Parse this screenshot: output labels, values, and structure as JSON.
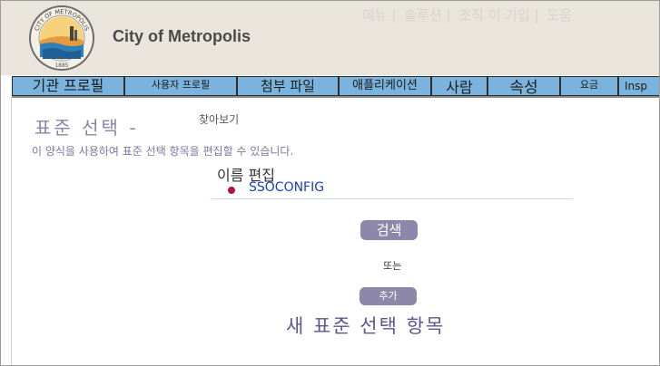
{
  "header": {
    "city_name": "City of Metropolis",
    "logo": {
      "top_text": "CITY OF METROPOLIS",
      "year": "1885"
    },
    "top_links": [
      "메뉴 |",
      "솔루션 |",
      "조직 이 가입 |",
      "도움"
    ]
  },
  "tabs": [
    {
      "label": "기관 프로필"
    },
    {
      "label": "사용자 프로필"
    },
    {
      "label": "첨부 파일"
    },
    {
      "label": "애플리케이션"
    },
    {
      "label": "사람"
    },
    {
      "label": "속성"
    },
    {
      "label": "요금"
    },
    {
      "label": "Insp"
    }
  ],
  "main": {
    "title": "표준 선택 -",
    "browse_link": "찾아보기",
    "description": "이 양식을 사용하여 표준 선택 항목을 편집할 수 있습니다.",
    "name_label": "이름 편집",
    "items": [
      {
        "label": "SSOCONFIG"
      }
    ],
    "search_button": "검색",
    "or_text": "또는",
    "add_button": "추가",
    "new_item_link": "새 표준 선택 항목"
  },
  "colors": {
    "header_bg": "#e9e4dc",
    "tab_bg": "#7ab3dd",
    "button_bg": "#8d87a9",
    "title_color": "#8a84aa",
    "link_color": "#1a3fc7",
    "bullet_color": "#b4163a"
  }
}
